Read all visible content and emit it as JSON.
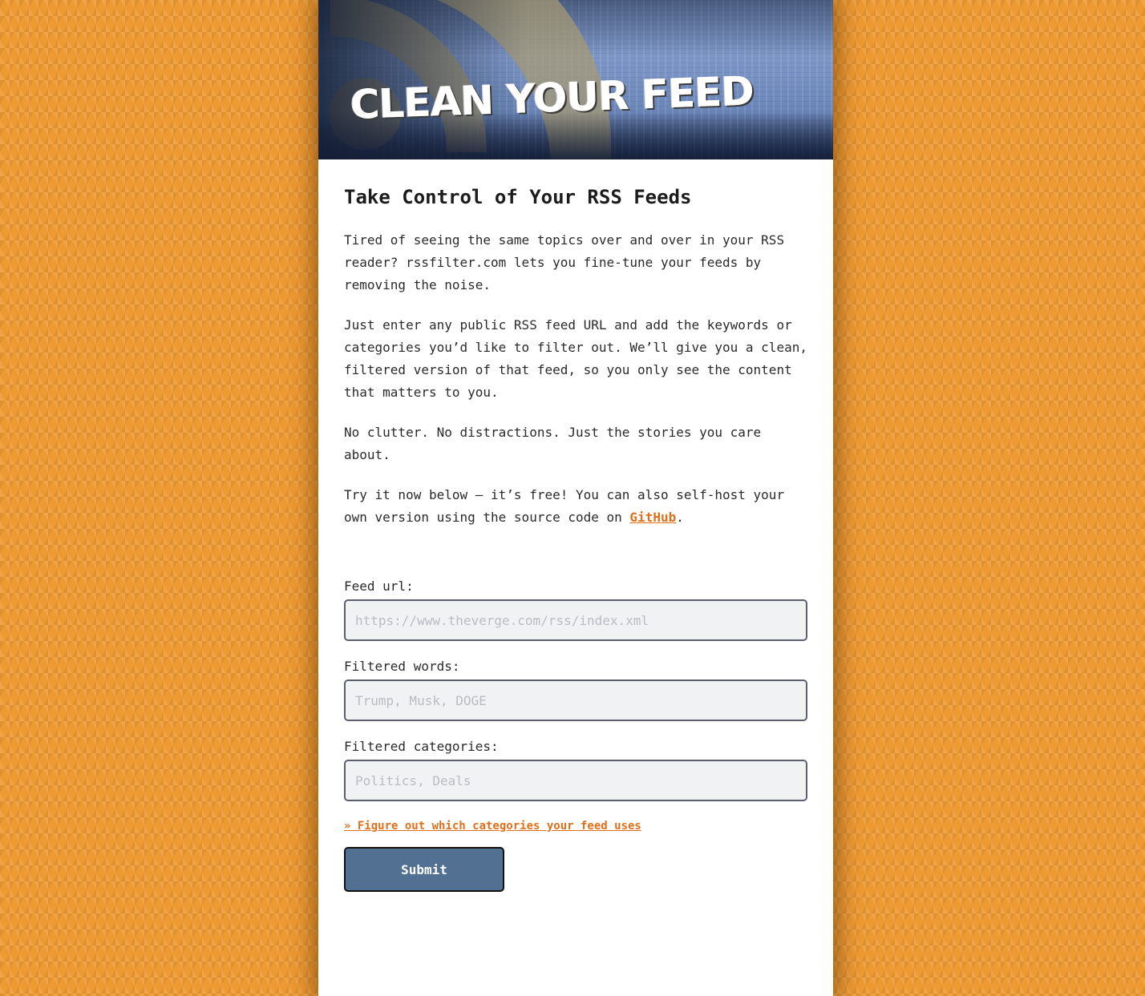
{
  "banner": {
    "title": "CLEAN YOUR FEED"
  },
  "main": {
    "heading": "Take Control of Your RSS Feeds",
    "paragraph_1": "Tired of seeing the same topics over and over in your RSS reader? rssfilter.com lets you fine-tune your feeds by removing the noise.",
    "paragraph_2": "Just enter any public RSS feed URL and add the keywords or categories you’d like to filter out. We’ll give you a clean, filtered version of that feed, so you only see the content that matters to you.",
    "paragraph_3": "No clutter. No distractions. Just the stories you care about.",
    "paragraph_4_before": "Try it now below — it’s free! You can also self-host your own version using the source code on ",
    "github_link": "GitHub",
    "paragraph_4_after": "."
  },
  "form": {
    "feed_url_label": "Feed url:",
    "feed_url_placeholder": "https://www.theverge.com/rss/index.xml",
    "feed_url_value": "",
    "filtered_words_label": "Filtered words:",
    "filtered_words_placeholder": "Trump, Musk, DOGE",
    "filtered_words_value": "",
    "filtered_categories_label": "Filtered categories:",
    "filtered_categories_placeholder": "Politics, Deals",
    "filtered_categories_value": "",
    "categories_link": "» Figure out which categories your feed uses",
    "submit_label": "Submit"
  },
  "colors": {
    "background": "#ee9a32",
    "accent_link": "#e06f1c",
    "submit_button": "#527192"
  },
  "icons": {
    "banner_graphic": "rss-icon"
  }
}
